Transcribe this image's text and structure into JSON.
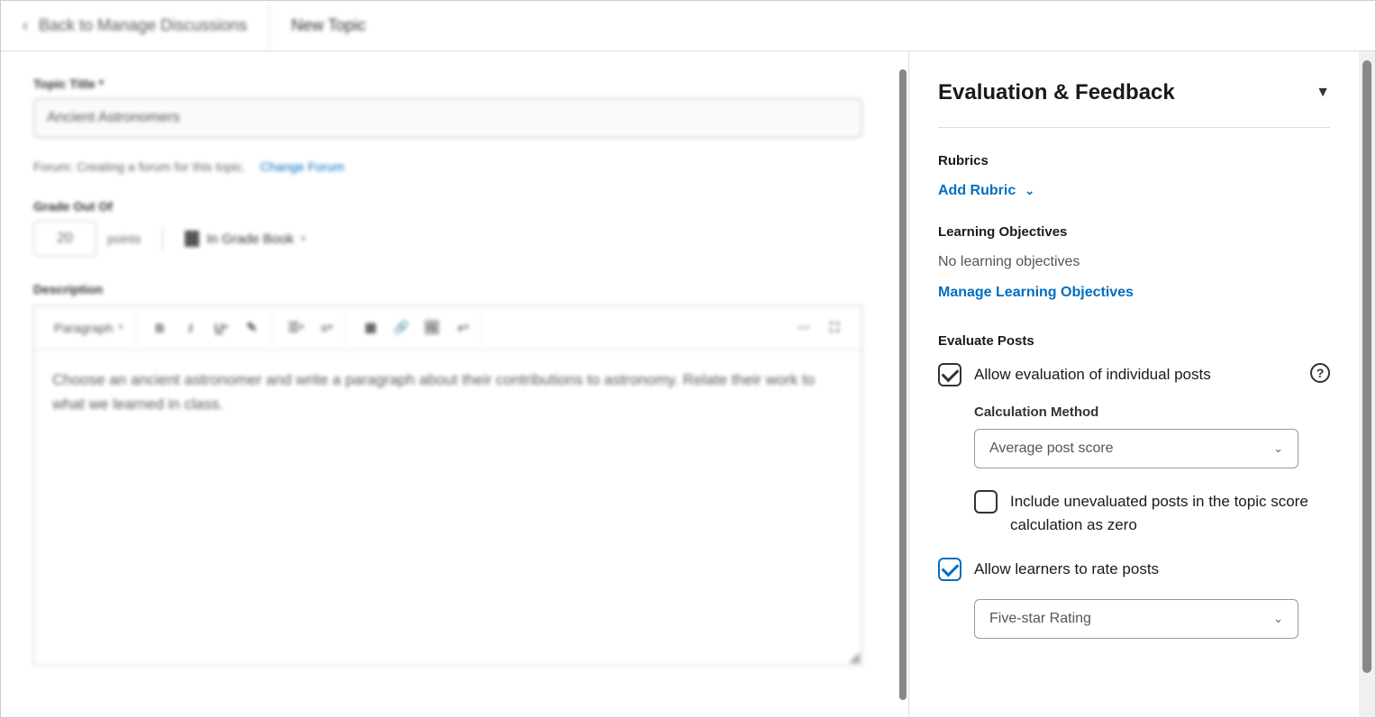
{
  "header": {
    "back_label": "Back to Manage Discussions",
    "page_heading": "New Topic"
  },
  "main": {
    "title_label": "Topic Title *",
    "title_value": "Ancient Astronomers",
    "forum_text": "Forum: Creating a forum for this topic.",
    "change_forum": "Change Forum",
    "grade_label": "Grade Out Of",
    "points_value": "20",
    "points_suffix": "points",
    "gradebook_label": "In Grade Book",
    "description_label": "Description",
    "toolbar": {
      "style": "Paragraph"
    },
    "description_text": "Choose an ancient astronomer and write a paragraph about their contributions to astronomy. Relate their work to what we learned in class."
  },
  "side": {
    "title": "Evaluation & Feedback",
    "rubrics_label": "Rubrics",
    "add_rubric": "Add Rubric",
    "objectives_label": "Learning Objectives",
    "no_objectives": "No learning objectives",
    "manage_objectives": "Manage Learning Objectives",
    "evaluate_label": "Evaluate Posts",
    "allow_eval": "Allow evaluation of individual posts",
    "calc_label": "Calculation Method",
    "calc_value": "Average post score",
    "include_zero": "Include unevaluated posts in the topic score calculation as zero",
    "allow_rate": "Allow learners to rate posts",
    "rating_value": "Five-star Rating"
  }
}
